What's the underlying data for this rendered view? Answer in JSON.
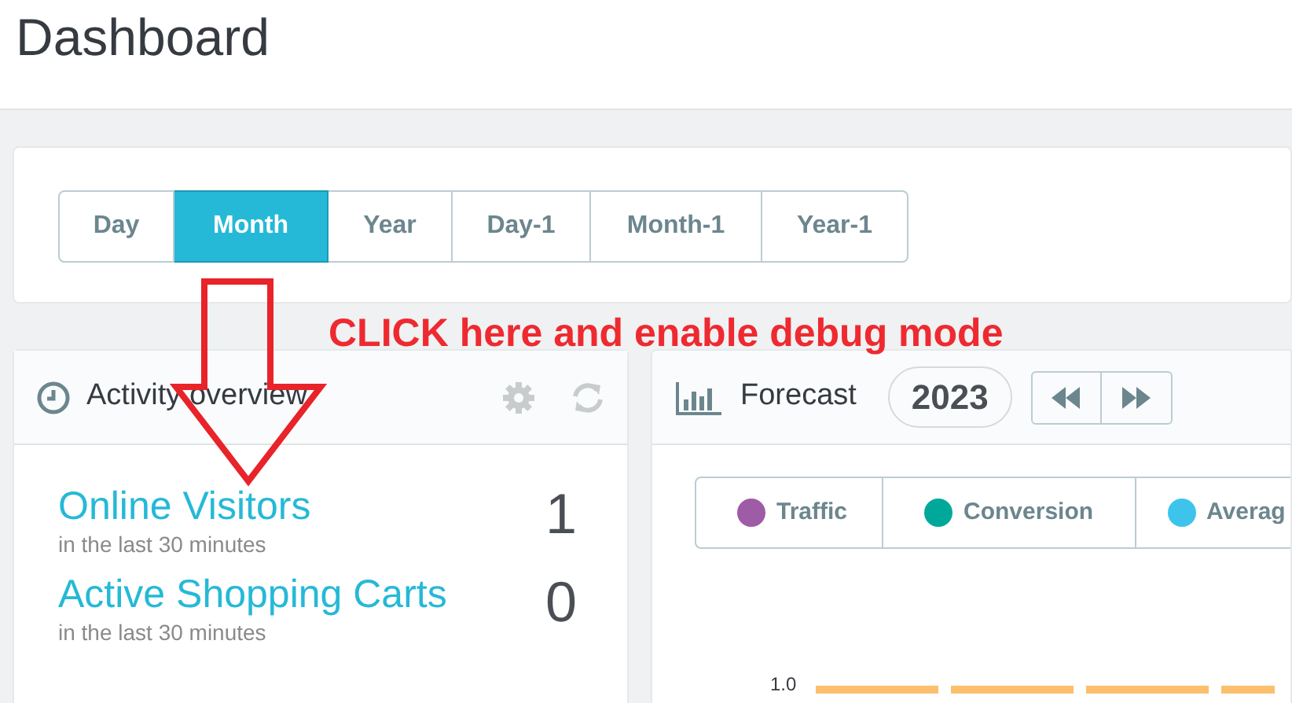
{
  "page_title": "Dashboard",
  "period_tabs": [
    {
      "label": "Day",
      "selected": false
    },
    {
      "label": "Month",
      "selected": true
    },
    {
      "label": "Year",
      "selected": false
    },
    {
      "label": "Day-1",
      "selected": false
    },
    {
      "label": "Month-1",
      "selected": false
    },
    {
      "label": "Year-1",
      "selected": false
    }
  ],
  "annotation": {
    "text": "CLICK here and enable debug mode"
  },
  "activity_panel": {
    "title": "Activity overview",
    "metrics": [
      {
        "label": "Online Visitors",
        "sublabel": "in the last 30 minutes",
        "value": "1"
      },
      {
        "label": "Active Shopping Carts",
        "sublabel": "in the last 30 minutes",
        "value": "0"
      }
    ]
  },
  "forecast_panel": {
    "title": "Forecast",
    "year": "2023",
    "legend": [
      {
        "label": "Traffic",
        "color": "#9e5ba6"
      },
      {
        "label": "Conversion",
        "color": "#00a89a"
      },
      {
        "label": "Averag",
        "color": "#3ec4ec"
      }
    ],
    "axis_label": "1.0"
  }
}
